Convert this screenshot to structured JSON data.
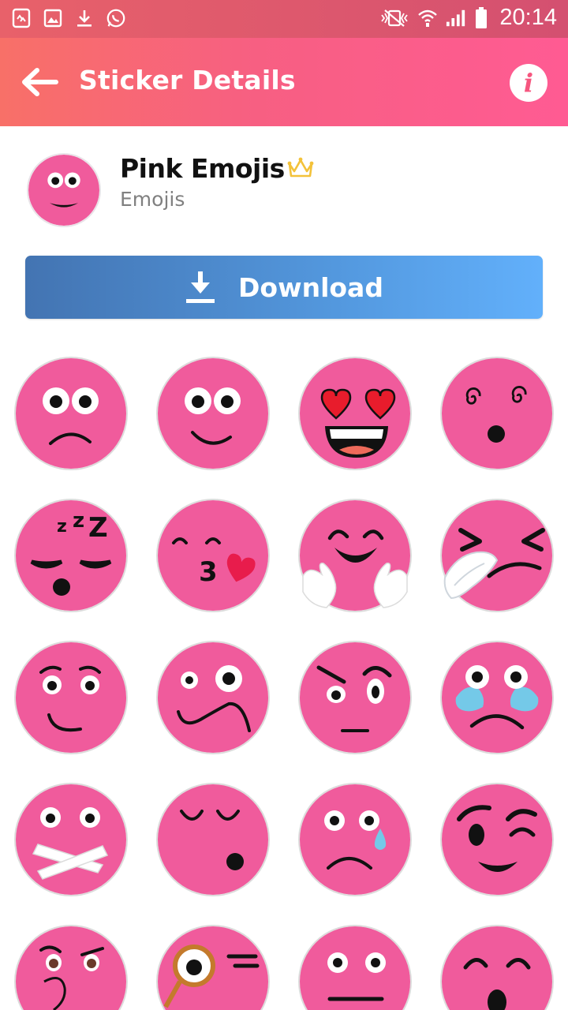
{
  "status_bar": {
    "time": "20:14",
    "left_icons": [
      "sim-swap-icon",
      "image-icon",
      "download-icon",
      "whatsapp-icon"
    ],
    "right_icons": [
      "vibrate-icon",
      "wifi-icon",
      "signal-icon",
      "battery-icon"
    ]
  },
  "app_bar": {
    "title": "Sticker Details",
    "back_icon": "arrow-back-icon",
    "info_label": "i"
  },
  "pack": {
    "name": "Pink Emojis",
    "category": "Emojis",
    "premium_icon": "crown-icon"
  },
  "download": {
    "label": "Download",
    "icon": "download-icon"
  },
  "colors": {
    "appbar_start": "#f87068",
    "appbar_end": "#ff5b93",
    "sticker_pink": "#f05b9c",
    "download_start": "#4374b2",
    "download_end": "#62b0fb",
    "crown": "#f3c23a"
  },
  "stickers": [
    {
      "name": "sad-face-sticker"
    },
    {
      "name": "smiling-face-sticker"
    },
    {
      "name": "heart-eyes-sticker"
    },
    {
      "name": "dizzy-face-sticker"
    },
    {
      "name": "sleeping-face-sticker"
    },
    {
      "name": "kissing-heart-sticker"
    },
    {
      "name": "hugging-face-sticker"
    },
    {
      "name": "sneezing-face-sticker"
    },
    {
      "name": "smirk-face-sticker"
    },
    {
      "name": "confused-face-sticker"
    },
    {
      "name": "suspicious-face-sticker"
    },
    {
      "name": "crying-face-sticker"
    },
    {
      "name": "taped-mouth-sticker"
    },
    {
      "name": "sleepy-face-sticker"
    },
    {
      "name": "tear-face-sticker"
    },
    {
      "name": "winking-face-sticker"
    },
    {
      "name": "thinking-face-sticker"
    },
    {
      "name": "monocle-face-sticker"
    },
    {
      "name": "tongue-face-sticker"
    },
    {
      "name": "surprised-face-sticker"
    }
  ]
}
